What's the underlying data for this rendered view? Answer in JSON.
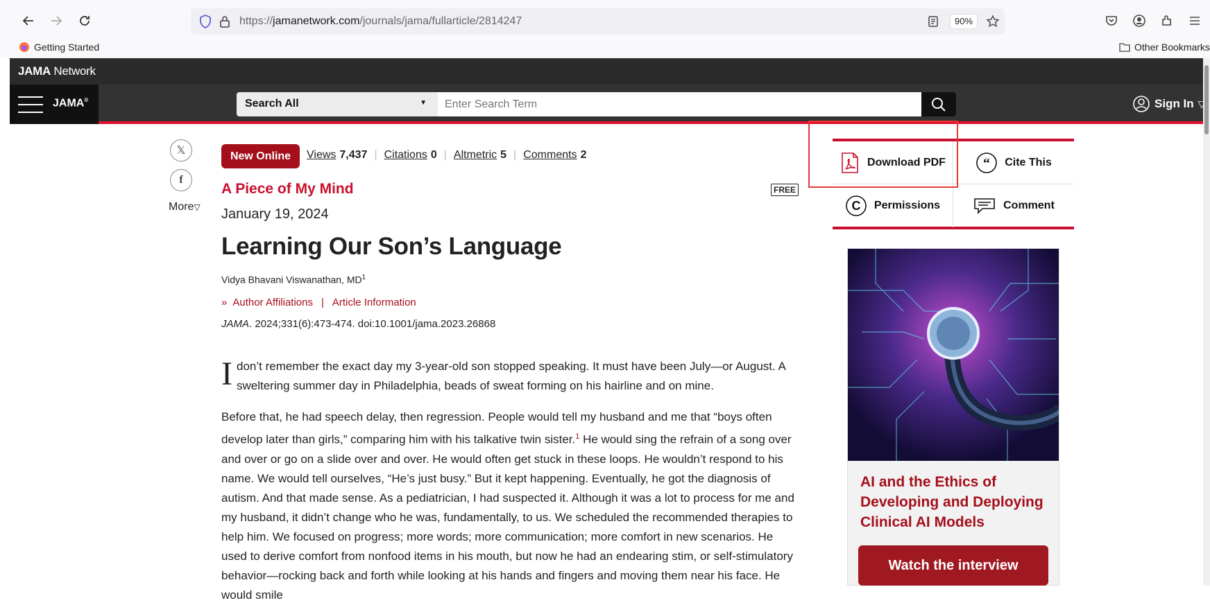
{
  "browser": {
    "url_prefix": "https://",
    "url_domain": "jamanetwork.com",
    "url_path": "/journals/jama/fullarticle/2814247",
    "zoom": "90%",
    "bookmarks": {
      "getting_started": "Getting Started",
      "other": "Other Bookmarks"
    }
  },
  "site": {
    "network_logo_bold": "JAMA",
    "network_logo_rest": " Network",
    "journal_badge": "JAMA",
    "search_scope": "Search All",
    "search_placeholder": "Enter Search Term",
    "sign_in": "Sign In"
  },
  "share": {
    "more": "More"
  },
  "article": {
    "badge": "New Online",
    "metrics": [
      {
        "label": "Views",
        "value": "7,437"
      },
      {
        "label": "Citations",
        "value": "0"
      },
      {
        "label": "Altmetric",
        "value": "5"
      },
      {
        "label": "Comments",
        "value": "2"
      }
    ],
    "section": "A Piece of My Mind",
    "free": "FREE",
    "date": "January 19, 2024",
    "title": "Learning Our Son’s Language",
    "author": "Vidya Bhavani Viswanathan, MD",
    "author_sup": "1",
    "author_affiliations": "Author Affiliations",
    "article_information": "Article Information",
    "citation_journal": "JAMA",
    "citation_rest": ". 2024;331(6):473-474. doi:10.1001/jama.2023.26868",
    "dropcap": "I",
    "para1": "don’t remember the exact day my 3-year-old son stopped speaking. It must have been July—or August. A sweltering summer day in Philadelphia, beads of sweat forming on his hairline and on mine.",
    "para2_a": "Before that, he had speech delay, then regression. People would tell my husband and me that “boys often develop later than girls,” comparing him with his talkative twin sister.",
    "para2_sup": "1",
    "para2_b": " He would sing the refrain of a song over and over or go on a slide over and over. He would often get stuck in these loops. He wouldn’t respond to his name. We would tell ourselves, “He’s just busy.” But it kept happening. Eventually, he got the diagnosis of autism. And that made sense. As a pediatrician, I had suspected it. Although it was a lot to process for me and my husband, it didn’t change who he was, fundamentally, to us. We scheduled the recommended therapies to help him. We focused on progress; more words; more communication; more comfort in new scenarios. He used to derive comfort from nonfood items in his mouth, but now he had an endearing stim, or self-stimulatory behavior—rocking back and forth while looking at his hands and fingers and moving them near his face. He would smile"
  },
  "tools": {
    "download_pdf": "Download PDF",
    "cite_this": "Cite This",
    "permissions": "Permissions",
    "comment": "Comment"
  },
  "ad": {
    "title": "AI and the Ethics of Developing and Deploying Clinical AI Models",
    "button": "Watch the interview"
  }
}
